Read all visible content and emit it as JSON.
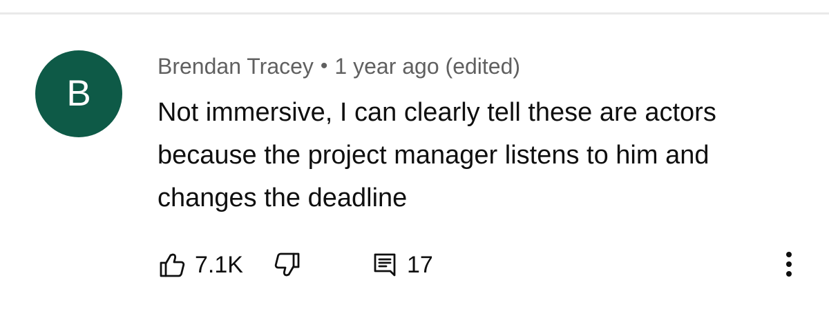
{
  "comment": {
    "avatar_letter": "B",
    "avatar_color": "#0e5a47",
    "author": "Brendan Tracey",
    "separator": "•",
    "time": "1 year ago (edited)",
    "text": "Not immersive, I can clearly tell these are actors\nbecause the project manager listens to him and\nchanges the deadline"
  },
  "actions": {
    "like_icon": "thumb-up-icon",
    "like_count": "7.1K",
    "dislike_icon": "thumb-down-icon",
    "reply_icon": "reply-comment-icon",
    "reply_count": "17",
    "more_icon": "more-vertical-icon"
  }
}
